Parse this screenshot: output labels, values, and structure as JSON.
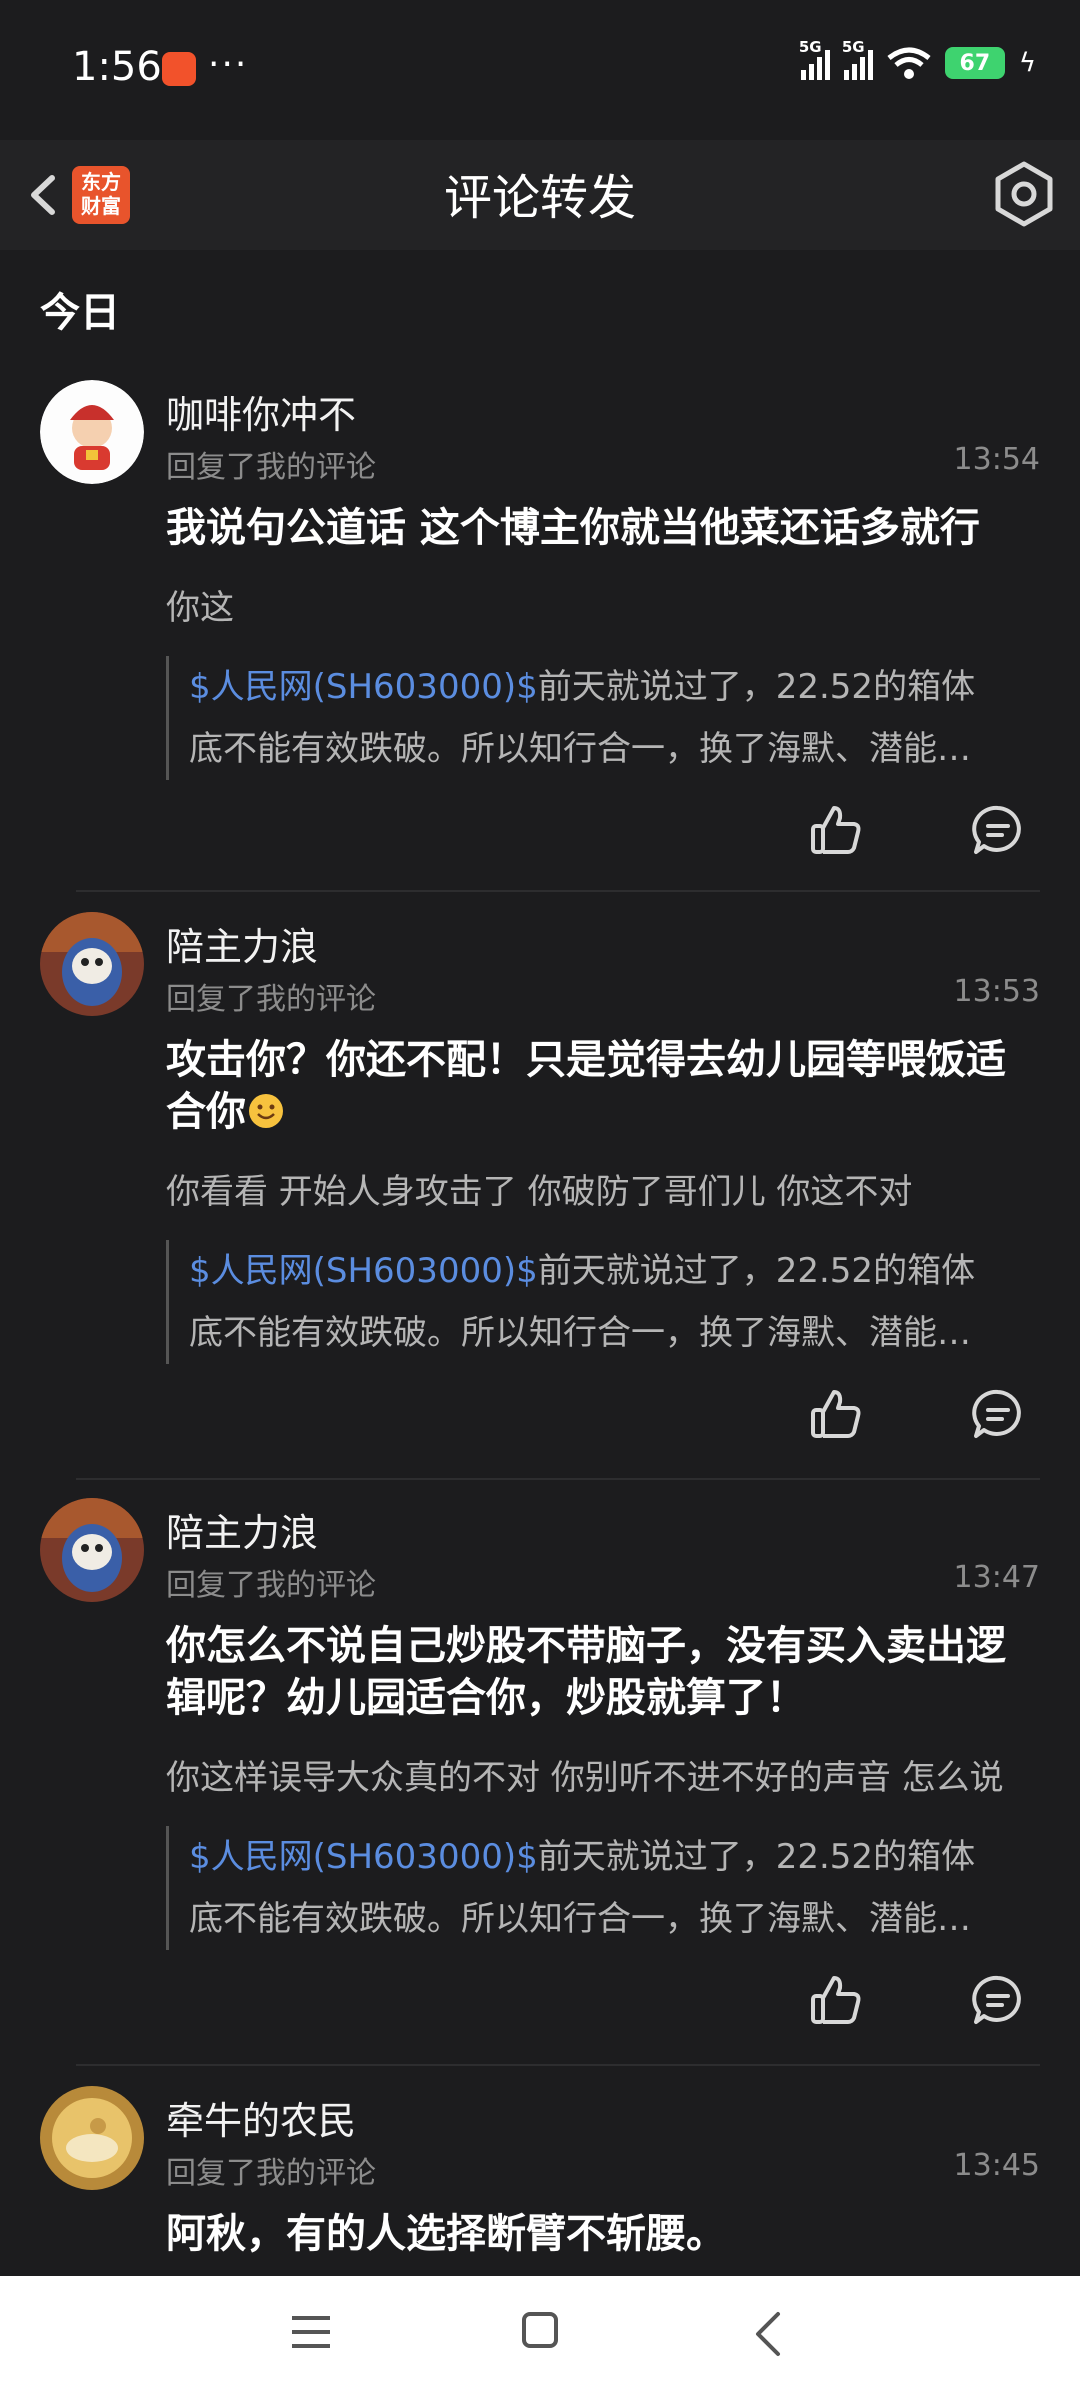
{
  "status": {
    "time": "1:56",
    "dots": "···",
    "net1": "5G",
    "net2": "5G",
    "battery": "67"
  },
  "header": {
    "logo_text": "东方财富",
    "title": "评论转发"
  },
  "section": "今日",
  "quote_tag": "$人民网(SH603000)$",
  "quote_line1": "前天就说过了，22.52的箱体",
  "quote_line2": "底不能有效跌破。所以知行合一，换了海默、潜能…",
  "items": [
    {
      "name": "咖啡你冲不",
      "action": "回复了我的评论",
      "time": "13:54",
      "reply": "我说句公道话 这个博主你就当他菜还话多就行",
      "mine": "你这"
    },
    {
      "name": "陪主力浪",
      "action": "回复了我的评论",
      "time": "13:53",
      "reply": "攻击你？你还不配！只是觉得去幼儿园等喂饭适合你",
      "mine": "你看看 开始人身攻击了 你破防了哥们儿 你这不对"
    },
    {
      "name": "陪主力浪",
      "action": "回复了我的评论",
      "time": "13:47",
      "reply": "你怎么不说自己炒股不带脑子，没有买入卖出逻辑呢？幼儿园适合你，炒股就算了！",
      "mine": "你这样误导大众真的不对 你别听不进不好的声音 怎么说"
    },
    {
      "name": "牵牛的农民",
      "action": "回复了我的评论",
      "time": "13:45",
      "reply": "阿秋，有的人选择断臂不斩腰。"
    }
  ]
}
